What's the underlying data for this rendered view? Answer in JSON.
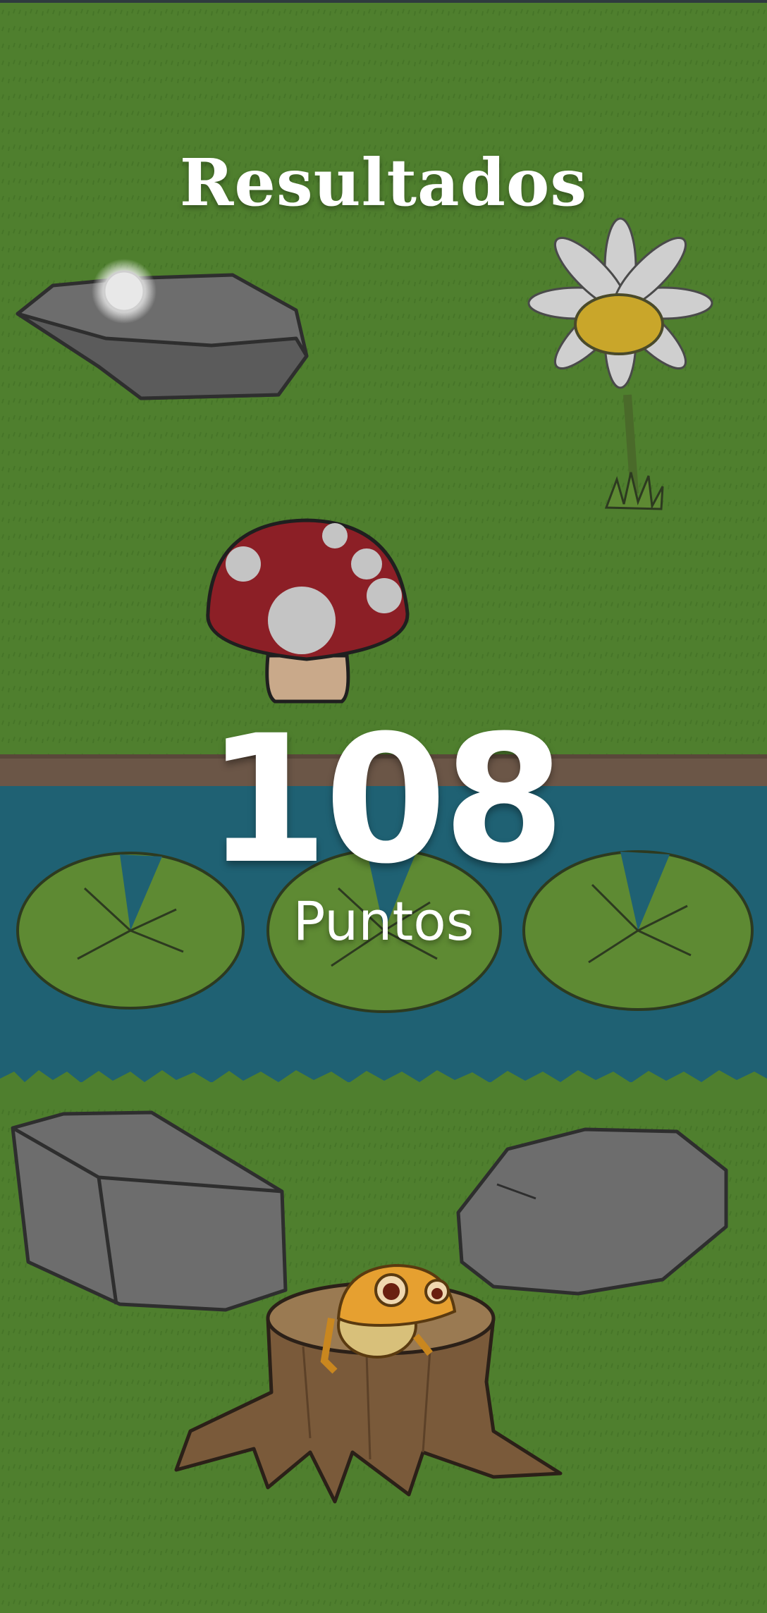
{
  "results": {
    "title": "Resultados",
    "score": "108",
    "score_label": "Puntos"
  },
  "colors": {
    "grass": "#4f7f2e",
    "water": "#1f6173",
    "riverbank": "#6b5647",
    "mushroom_cap": "#8c1f26",
    "lily_pad": "#5e8a33",
    "rock": "#6d6d6d",
    "frog": "#e6a030"
  },
  "icons": [
    "glowing-orb-icon",
    "daisy-icon",
    "mushroom-icon",
    "lily-pad-icon",
    "rock-icon",
    "tree-stump-icon",
    "frog-icon"
  ]
}
